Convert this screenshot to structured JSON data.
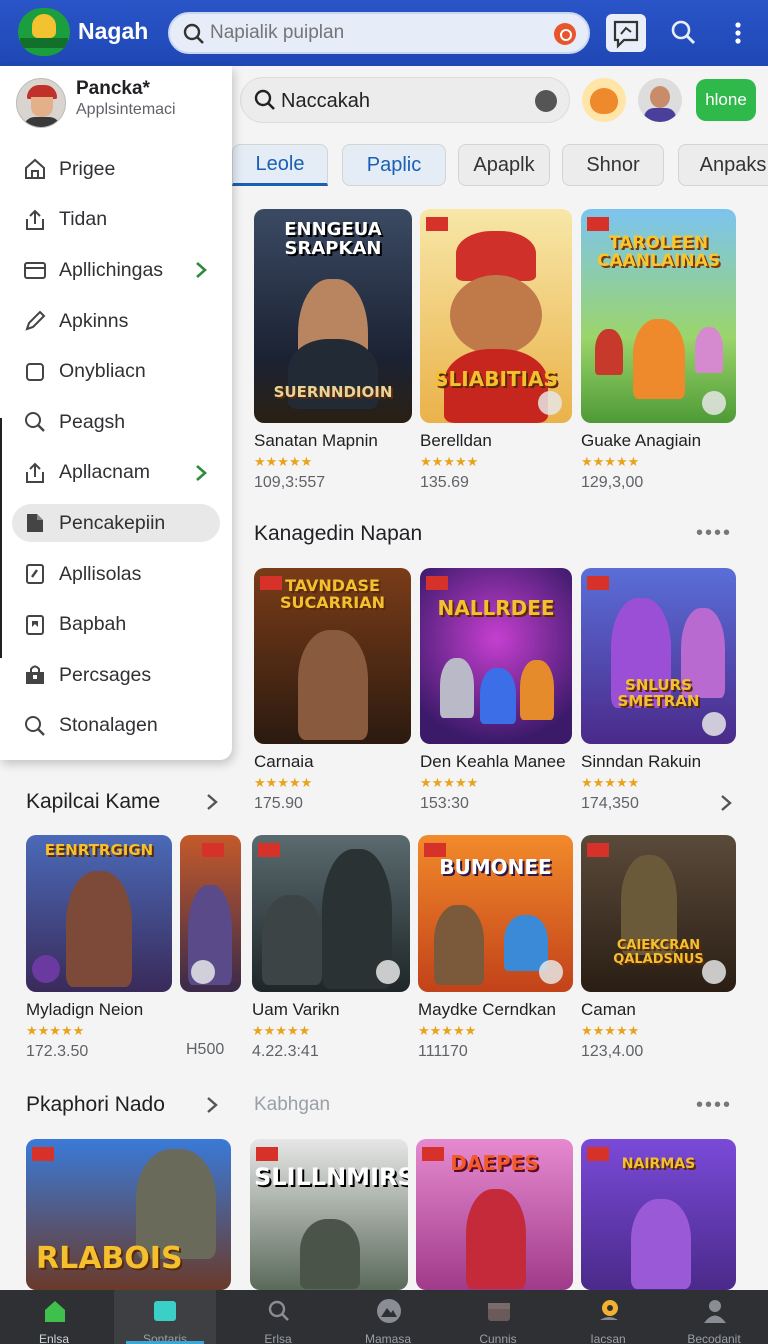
{
  "topbar": {
    "brand": "Nagah",
    "search_placeholder": "Napialik puiplan"
  },
  "drawer": {
    "user_name": "Pancka*",
    "user_subtitle": "Applsintemaci",
    "items": [
      {
        "label": "Prigee",
        "icon": "home-icon"
      },
      {
        "label": "Tidan",
        "icon": "share-icon"
      },
      {
        "label": "Apllichingas",
        "icon": "window-icon",
        "chevron": true
      },
      {
        "label": "Apkinns",
        "icon": "pencil-icon"
      },
      {
        "label": "Onybliacn",
        "icon": "square-icon"
      },
      {
        "label": "Peagsh",
        "icon": "search-icon"
      },
      {
        "label": "Apllacnam",
        "icon": "share-icon",
        "chevron": true
      },
      {
        "label": "Pencakepiin",
        "icon": "bookmark-icon",
        "active": true
      },
      {
        "label": "Apllisolas",
        "icon": "note-icon"
      },
      {
        "label": "Bapbah",
        "icon": "tag-icon"
      },
      {
        "label": "Percsages",
        "icon": "bag-icon"
      },
      {
        "label": "Stonalagen",
        "icon": "search-icon"
      }
    ]
  },
  "content": {
    "search_value": "Naccakah",
    "home_button": "hlone",
    "tabs": [
      "Leole",
      "Paplic",
      "Apaplk",
      "Shnor",
      "Anpaks"
    ],
    "row1": [
      {
        "name": "Sanatan Mapnin",
        "count": "109,3:557",
        "art_title": "ENNGEUA SRAPKAN",
        "art_sub": "SUERNNDIOIN"
      },
      {
        "name": "Berelldan",
        "count": "135.69",
        "art_title": "SLIABITIAS",
        "art_sub": ""
      },
      {
        "name": "Guake Anagiain",
        "count": "129,3,00",
        "art_title": "TAROLEEN CAANLAINAS",
        "art_sub": ""
      }
    ],
    "section1_title": "Kanagedin Napan",
    "row2": [
      {
        "name": "Carnaia",
        "count": "175.90",
        "art_title": "TAVNDASE SUCARRIAN"
      },
      {
        "name": "Den Keahla Manee",
        "count": "153:30",
        "art_title": "NALLRDEE"
      },
      {
        "name": "Sinndan Rakuin",
        "count": "174,350",
        "art_title": "SNLURS SMETRAN"
      }
    ],
    "section2_title": "Kapilcai Kame",
    "row3": [
      {
        "name": "Myladign Neion",
        "count": "172.3.50",
        "art_title": "EENRTRGIGN"
      },
      {
        "name": "",
        "count": "",
        "art_title": ""
      },
      {
        "name": "Uam Varikn",
        "count": "4.22.3:41",
        "art_title": ""
      },
      {
        "name": "Maydke Cerndkan",
        "count": "111170",
        "art_title": "BUMONEE"
      },
      {
        "name": "Caman",
        "count": "123,4.00",
        "art_title": "CAIEKCRAN QALADSNUS"
      }
    ],
    "row3_side_count": "H500",
    "section3_title": "Pkaphori Nado",
    "section3_aux": "Kabhgan",
    "row4": [
      {
        "art_title": "RLABOIS"
      },
      {
        "art_title": "SLILLNMIRS"
      },
      {
        "art_title": "DAEPES"
      },
      {
        "art_title": "NAIRMAS"
      }
    ]
  },
  "bottom_nav": [
    {
      "label": "Enlsa",
      "icon": "home-icon"
    },
    {
      "label": "Sontaris",
      "icon": "tablet-icon"
    },
    {
      "label": "Erlsa",
      "icon": "search-icon"
    },
    {
      "label": "Mamasa",
      "icon": "mountain-icon"
    },
    {
      "label": "Cunnis",
      "icon": "box-icon"
    },
    {
      "label": "Iacsan",
      "icon": "pin-icon"
    },
    {
      "label": "Becodanit",
      "icon": "person-icon"
    }
  ],
  "colors": {
    "topbar": "#2a55c8",
    "accent": "#1a5fb4",
    "home_button": "#2fb94a",
    "star": "#e9a21b",
    "nav_bg": "#2f3033"
  }
}
